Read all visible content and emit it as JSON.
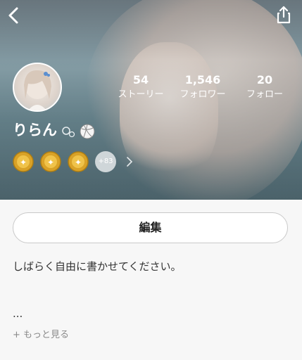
{
  "header": {
    "back_icon": "chevron-left-icon",
    "share_icon": "share-icon"
  },
  "profile": {
    "username": "りらん",
    "stats": [
      {
        "value": "54",
        "label": "ストーリー"
      },
      {
        "value": "1,546",
        "label": "フォロワー"
      },
      {
        "value": "20",
        "label": "フォロー"
      }
    ],
    "badges_more": "+83",
    "edit_label": "編集",
    "bio": "しばらく自由に書かせてください。",
    "bio_ellipsis": "...",
    "see_more": "+ もっと見る"
  },
  "colors": {
    "badge_gold": "#d9a227",
    "text_dark": "#222222",
    "muted": "#8a8a8a"
  }
}
